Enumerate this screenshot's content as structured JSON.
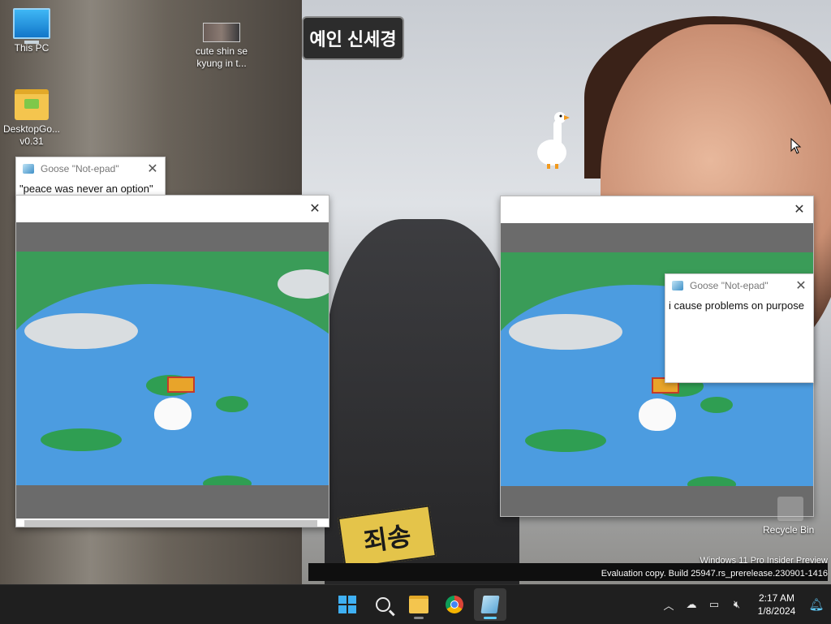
{
  "desktop": {
    "icons": [
      {
        "label": "This PC",
        "icon": "computer-icon"
      },
      {
        "label": "DesktopGo... v0.31",
        "icon": "folder-icon"
      },
      {
        "label": "cute shin se kyung in t...",
        "icon": "image-file-icon"
      }
    ],
    "recycle_bin": {
      "label": "Recycle Bin",
      "icon": "recycle-bin-icon"
    }
  },
  "wallpaper": {
    "caption_top": "예인 신세경",
    "caption_sign": "죄송"
  },
  "windows": {
    "note_left": {
      "title": "Goose \"Not-epad\"",
      "text": "\"peace was never an option\""
    },
    "note_right": {
      "title": "Goose \"Not-epad\"",
      "text": "i cause problems on purpose"
    },
    "video_left": {
      "title": ""
    },
    "video_right": {
      "title": ""
    }
  },
  "watermark": {
    "line1": "Windows 11 Pro Insider Preview",
    "line2": "Evaluation copy. Build 25947.rs_prerelease.230901-1416"
  },
  "taskbar": {
    "apps": [
      {
        "name": "Start",
        "icon": "windows-start-icon"
      },
      {
        "name": "Search",
        "icon": "search-icon"
      },
      {
        "name": "File Explorer",
        "icon": "file-explorer-icon"
      },
      {
        "name": "Google Chrome",
        "icon": "chrome-icon"
      },
      {
        "name": "Notepad",
        "icon": "notepad-icon"
      }
    ],
    "clock": {
      "time": "2:17 AM",
      "date": "1/8/2024"
    },
    "tray": [
      "chevron-up-icon",
      "onedrive-icon",
      "network-icon",
      "volume-muted-icon",
      "notification-bell-icon"
    ]
  },
  "colors": {
    "taskbar_bg": "#1f1f1f",
    "accent": "#60cdff",
    "pond_water": "#4c9ce0",
    "pond_grass": "#3a9c58"
  }
}
